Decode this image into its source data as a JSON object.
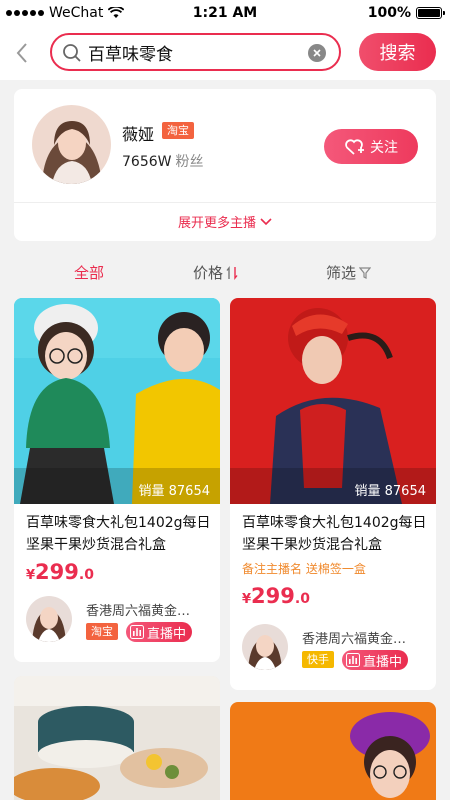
{
  "status_bar": {
    "carrier": "WeChat",
    "time": "1:21 AM",
    "battery": "100%"
  },
  "search": {
    "query": "百草味零食",
    "button_label": "搜索"
  },
  "anchor": {
    "name": "薇娅",
    "platform_tag": "淘宝",
    "fans_count": "7656W",
    "fans_unit": "粉丝",
    "follow_label": "关注",
    "expand_label": "展开更多主播"
  },
  "sort_tabs": [
    {
      "label": "全部",
      "active": true
    },
    {
      "label": "价格",
      "active": false
    },
    {
      "label": "筛选",
      "active": false
    }
  ],
  "products": [
    {
      "sales": "销量 87654",
      "title": "百草味零食大礼包1402g每日坚果干果炒货混合礼盒",
      "promo": "",
      "price_currency": "¥",
      "price_int": "299",
      "price_dec": ".0",
      "shop_name": "香港周六福黄金…",
      "platform": "淘宝",
      "platform_color": "#f3633f",
      "live_label": "直播中"
    },
    {
      "sales": "销量 87654",
      "title": "百草味零食大礼包1402g每日坚果干果炒货混合礼盒",
      "promo": "备注主播名 送棉签一盒",
      "price_currency": "¥",
      "price_int": "299",
      "price_dec": ".0",
      "shop_name": "香港周六福黄金…",
      "platform": "快手",
      "platform_color": "#f5b800",
      "live_label": "直播中"
    }
  ],
  "colors": {
    "accent": "#ea2d4f"
  }
}
